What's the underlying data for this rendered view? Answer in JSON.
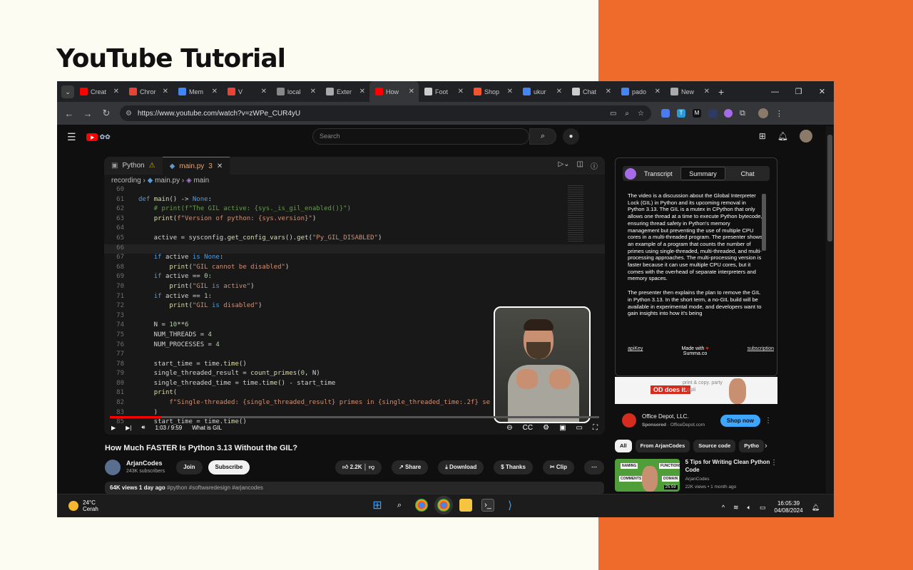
{
  "page": {
    "heading": "YouTube Tutorial"
  },
  "browser": {
    "tabs": [
      {
        "label": "Creat",
        "icon_color": "#ff0000",
        "icon": "youtube-icon"
      },
      {
        "label": "Chror",
        "icon_color": "#ea4335",
        "icon": "gmail-icon"
      },
      {
        "label": "Mem",
        "icon_color": "#4285f4",
        "icon": "chrome-icon"
      },
      {
        "label": "V",
        "icon_color": "#ea4335",
        "icon": "gmail-icon"
      },
      {
        "label": "local",
        "icon_color": "#888888",
        "icon": "globe-icon"
      },
      {
        "label": "Exter",
        "icon_color": "#aaaaaa",
        "icon": "puzzle-icon"
      },
      {
        "label": "How",
        "icon_color": "#ff0000",
        "icon": "youtube-icon",
        "active": true
      },
      {
        "label": "Foot",
        "icon_color": "#cccccc",
        "icon": "chatgpt-icon"
      },
      {
        "label": "Shop",
        "icon_color": "#f2542d",
        "icon": "shopee-icon"
      },
      {
        "label": "ukur",
        "icon_color": "#4285f4",
        "icon": "google-icon"
      },
      {
        "label": "Chat",
        "icon_color": "#cccccc",
        "icon": "chatgpt-icon"
      },
      {
        "label": "pado",
        "icon_color": "#4285f4",
        "icon": "google-icon"
      },
      {
        "label": "New",
        "icon_color": "#aaaaaa",
        "icon": "chrome-icon"
      }
    ],
    "url": "https://www.youtube.com/watch?v=zWPe_CUR4yU"
  },
  "youtube": {
    "search_placeholder": "Search",
    "editor": {
      "tab1": "Python",
      "tab2": "main.py",
      "tab2_badge": "3",
      "crumb1": "recording",
      "crumb2": "main.py",
      "crumb3": "main",
      "lines": [
        {
          "n": "60",
          "t": ""
        },
        {
          "n": "61",
          "t": "def main() -> None:"
        },
        {
          "n": "62",
          "t": "    # print(f\"The GIL active: {sys._is_gil_enabled()}\")"
        },
        {
          "n": "63",
          "t": "    print(f\"Version of python: {sys.version}\")"
        },
        {
          "n": "64",
          "t": ""
        },
        {
          "n": "65",
          "t": "    active = sysconfig.get_config_vars().get(\"Py_GIL_DISABLED\")"
        },
        {
          "n": "66",
          "t": ""
        },
        {
          "n": "67",
          "t": "    if active is None:"
        },
        {
          "n": "68",
          "t": "        print(\"GIL cannot be disabled\")"
        },
        {
          "n": "69",
          "t": "    if active == 0:"
        },
        {
          "n": "70",
          "t": "        print(\"GIL is active\")"
        },
        {
          "n": "71",
          "t": "    if active == 1:"
        },
        {
          "n": "72",
          "t": "        print(\"GIL is disabled\")"
        },
        {
          "n": "73",
          "t": ""
        },
        {
          "n": "74",
          "t": "    N = 10**6"
        },
        {
          "n": "75",
          "t": "    NUM_THREADS = 4"
        },
        {
          "n": "76",
          "t": "    NUM_PROCESSES = 4"
        },
        {
          "n": "77",
          "t": ""
        },
        {
          "n": "78",
          "t": "    start_time = time.time()"
        },
        {
          "n": "79",
          "t": "    single_threaded_result = count_primes(0, N)"
        },
        {
          "n": "80",
          "t": "    single_threaded_time = time.time() - start_time"
        },
        {
          "n": "81",
          "t": "    print("
        },
        {
          "n": "82",
          "t": "        f\"Single-threaded: {single_threaded_result} primes in {single_threaded_time:.2f} se"
        },
        {
          "n": "83",
          "t": "    )"
        },
        {
          "n": "85",
          "t": "    start_time = time.time()"
        }
      ]
    },
    "player": {
      "time": "1:03 / 9:59",
      "chapter": "What is GIL",
      "progress_fraction": 0.105
    },
    "video_title": "How Much FASTER Is Python 3.13 Without the GIL?",
    "channel": {
      "name": "ArjanCodes",
      "subscribers": "243K subscribers",
      "join": "Join",
      "subscribe": "Subscribe"
    },
    "actions": {
      "likes": "2.2K",
      "share": "Share",
      "download": "Download",
      "thanks": "Thanks",
      "clip": "Clip"
    },
    "description": {
      "meta": "64K views  1 day ago",
      "tags": "#python #softwaredesign #arjancodes"
    },
    "summary_panel": {
      "tabs": [
        "Transcript",
        "Summary",
        "Chat"
      ],
      "paragraph1": "The video is a discussion about the Global Interpreter Lock (GIL) in Python and its upcoming removal in Python 3.13. The GIL is a mutex in CPython that only allows one thread at a time to execute Python bytecode, ensuring thread safety in Python's memory management but preventing the use of multiple CPU cores in a multi-threaded program. The presenter shows an example of a program that counts the number of primes using single-threaded, multi-threaded, and multi-processing approaches. The multi-processing version is faster because it can use multiple CPU cores, but it comes with the overhead of separate interpreters and memory spaces.",
      "paragraph2": "The presenter then explains the plan to remove the GIL in Python 3.13. In the short term, a no-GIL build will be available in experimental mode, and developers want to gain insights into how it's being",
      "footer_left": "apiKey",
      "footer_mid1": "Made with",
      "footer_mid2": "Summa.co",
      "footer_right": "subscription"
    },
    "ad": {
      "banner_logo": "OD",
      "banner_logo_text": "does it.",
      "banner_text": "print & copy. party suppli",
      "advertiser": "Office Depot, LLC.",
      "sponsored": "Sponsored",
      "domain": "OfficeDepot.com",
      "cta": "Shop now"
    },
    "chips": [
      "All",
      "From ArjanCodes",
      "Source code",
      "Pytho"
    ],
    "recommendation": {
      "title": "5 Tips for Writing Clean Python Code",
      "channel": "ArjanCodes",
      "meta": "22K views  •  1 month ago",
      "duration": "25:59",
      "thumb_labels": [
        "NAMING",
        "FUNCTIONS",
        "COMMENTS",
        "DOMAIN"
      ]
    }
  },
  "taskbar": {
    "temp": "24°C",
    "weather": "Cerah",
    "time": "16:05:39",
    "date": "04/08/2024"
  }
}
